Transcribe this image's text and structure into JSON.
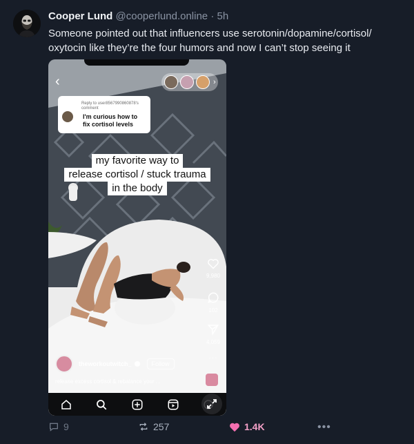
{
  "post": {
    "author": "Cooper Lund",
    "handle": "@cooperlund.online",
    "separator": "·",
    "time": "5h",
    "text": "Someone pointed out that influencers use serotonin/dopamine/cortisol/ oxytocin like they’re the four humors and now I can’t stop seeing it"
  },
  "video": {
    "reply_meta": "Reply to user8567990860878's comment",
    "reply_text": "I'm curious how to fix cortisol levels",
    "caption_lines": [
      "my favorite way to",
      "release cortisol / stuck trauma",
      "in the body"
    ],
    "likes": "9,980",
    "comments": "102",
    "shares": "4,059",
    "username": "theworkoutwitch_",
    "follow_label": "Follow",
    "description": "release excess cortisol & rebalance your ..."
  },
  "actions": {
    "replies": "9",
    "reposts": "257",
    "likes": "1.4K",
    "more": "•••"
  },
  "colors": {
    "background": "#171d28",
    "like_accent": "#f36fb0",
    "muted": "#8a93a3"
  }
}
